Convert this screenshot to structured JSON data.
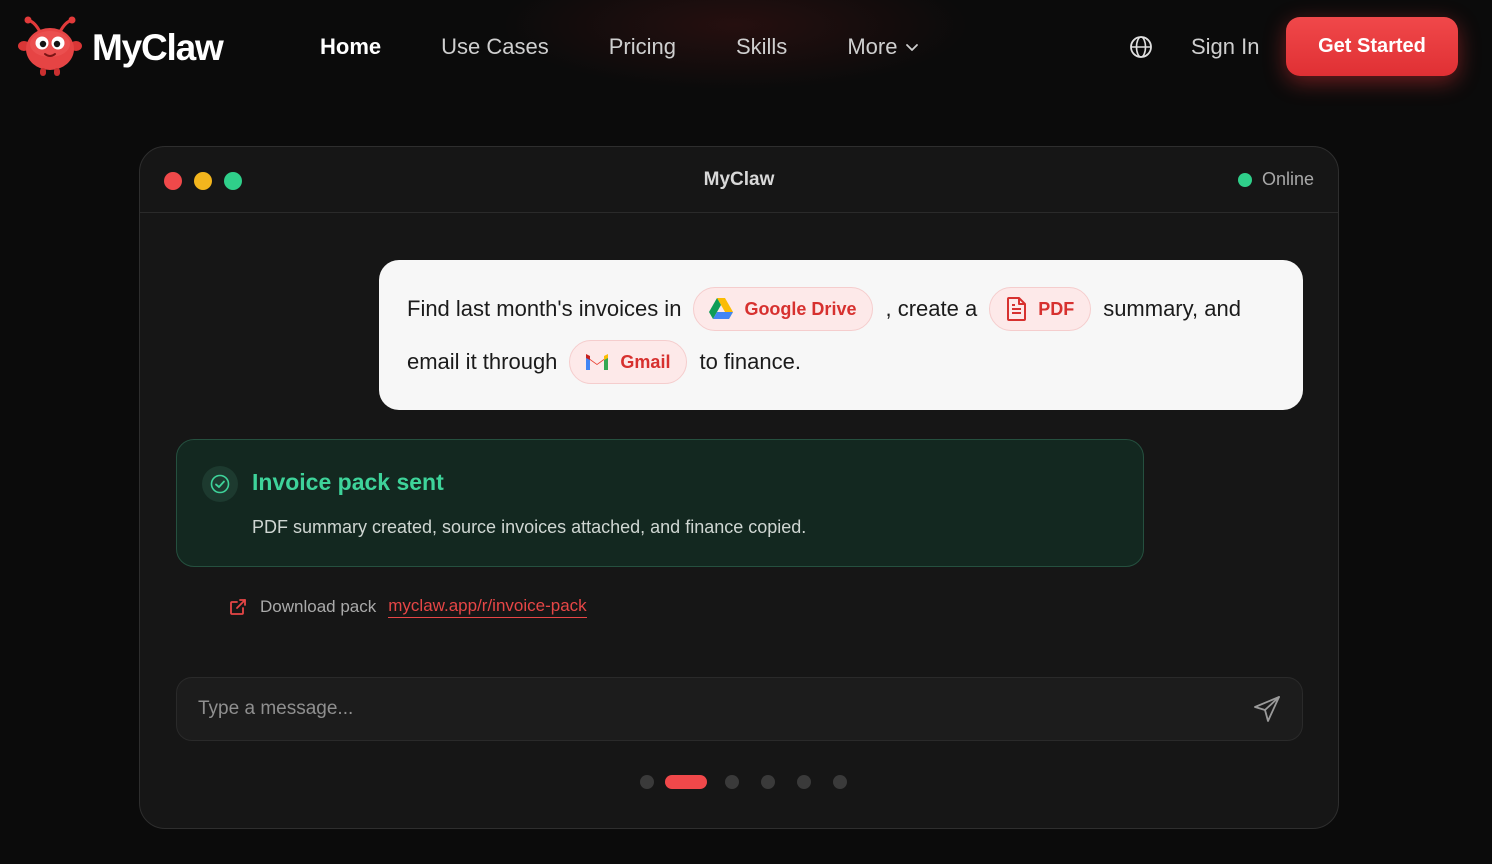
{
  "brand": {
    "name": "MyClaw"
  },
  "nav": {
    "links": [
      "Home",
      "Use Cases",
      "Pricing",
      "Skills",
      "More"
    ],
    "active": "Home",
    "sign_in": "Sign In",
    "cta": "Get Started"
  },
  "window": {
    "title": "MyClaw",
    "status": "Online",
    "user_message": {
      "t1": "Find last month's invoices in",
      "chip1": "Google Drive",
      "t2": ", create a",
      "chip2": "PDF",
      "t3": "summary, and",
      "t4": "email it through",
      "chip3": "Gmail",
      "t5": "to finance."
    },
    "result": {
      "title": "Invoice pack sent",
      "description": "PDF summary created, source invoices attached, and finance copied."
    },
    "download": {
      "label": "Download pack",
      "link": "myclaw.app/r/invoice-pack"
    },
    "composer": {
      "placeholder": "Type a message..."
    },
    "pager": {
      "count": 6,
      "active_index": 1
    }
  },
  "colors": {
    "accent": "#f0484a",
    "success": "#3ed39a",
    "background": "#0b0b0b",
    "window": "#161616"
  },
  "icons": [
    "globe-icon",
    "chevron-down-icon",
    "google-drive-icon",
    "pdf-file-icon",
    "gmail-icon",
    "check-circle-icon",
    "external-link-icon",
    "send-icon"
  ]
}
